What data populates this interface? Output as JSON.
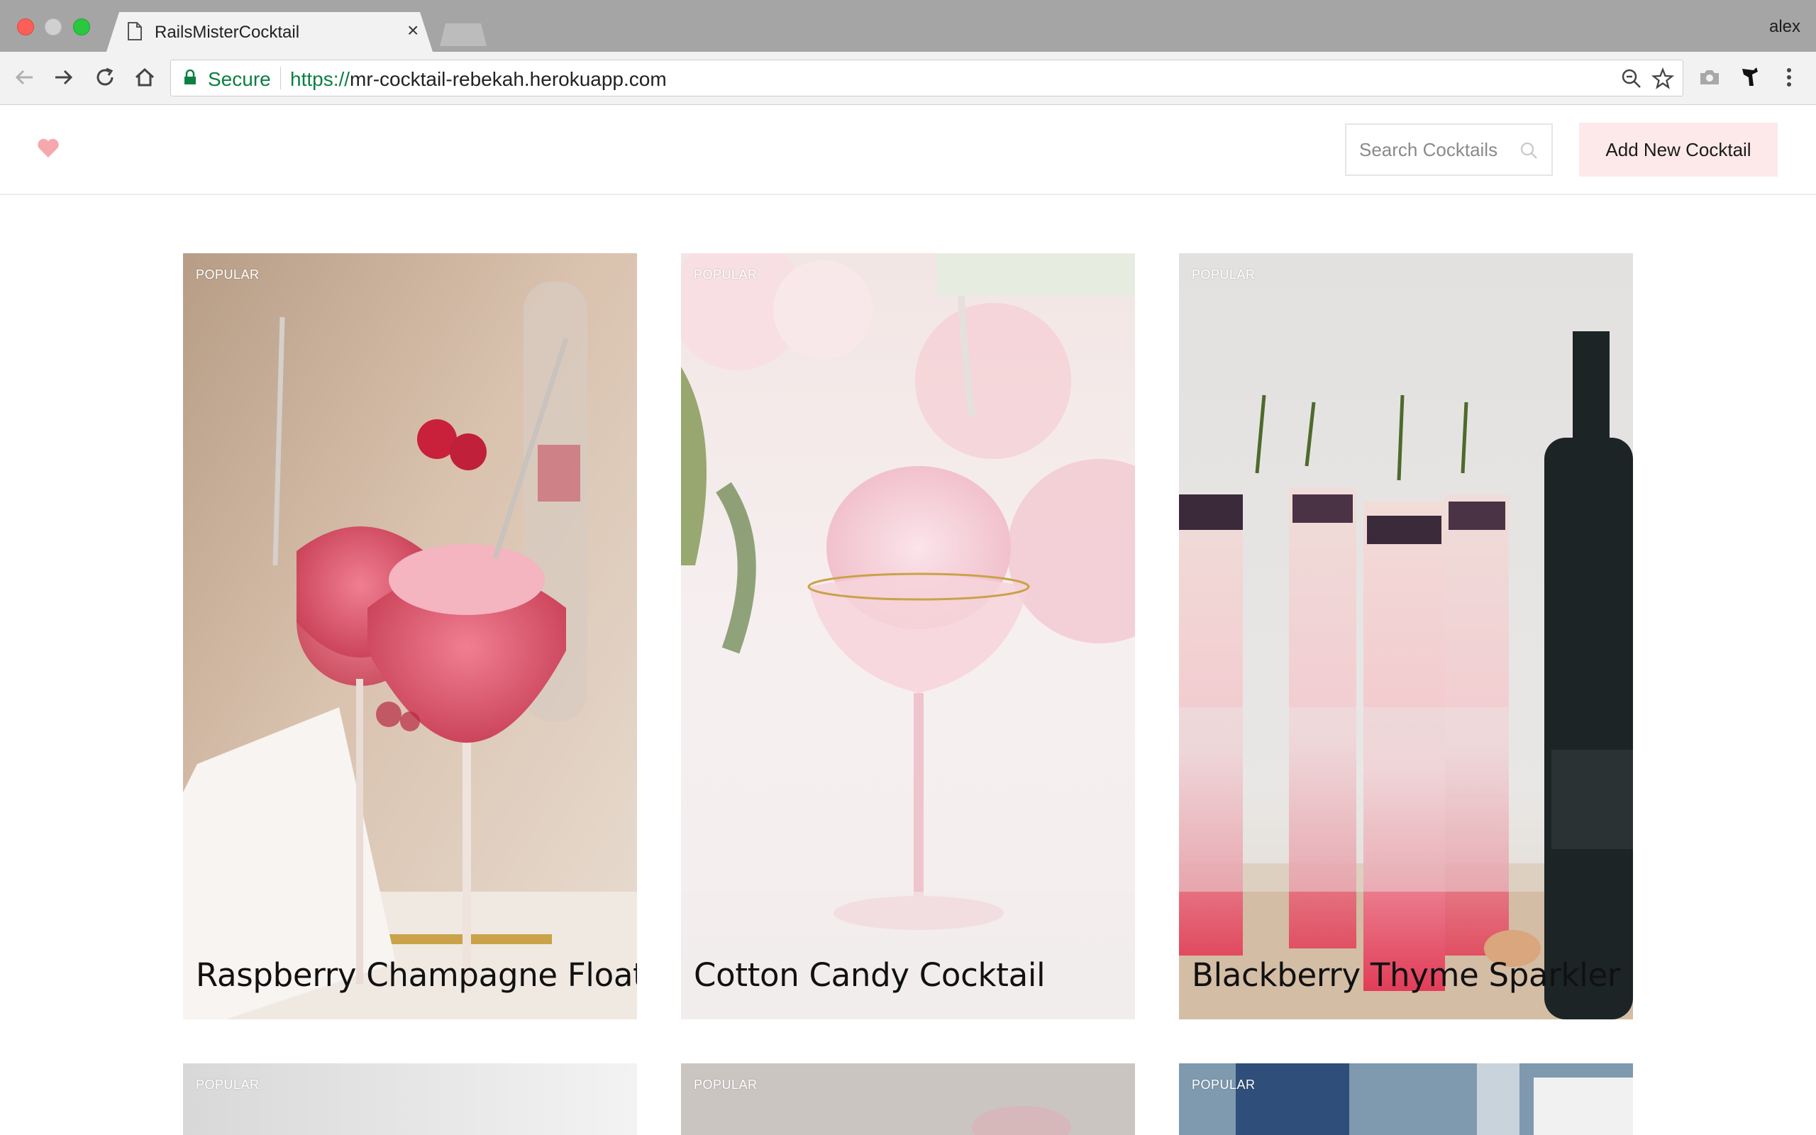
{
  "browser": {
    "tab_title": "RailsMisterCocktail",
    "tab_close": "×",
    "profile_name": "alex",
    "security_label": "Secure",
    "url_scheme": "https://",
    "url_host": "mr-cocktail-rebekah.herokuapp.com",
    "icons": [
      "back-icon",
      "forward-icon",
      "reload-icon",
      "home-icon",
      "lock-icon",
      "zoom-icon",
      "bookmark-star-icon",
      "camera-icon",
      "extension-icon",
      "menu-icon"
    ]
  },
  "header": {
    "logo_icon": "heart-icon",
    "logo_color": "#f7a8ad",
    "search_placeholder": "Search Cocktails",
    "add_button_label": "Add New Cocktail",
    "add_button_color": "#fde9ea"
  },
  "cocktails": [
    {
      "badge": "POPULAR",
      "title": "Raspberry Champagne Float"
    },
    {
      "badge": "POPULAR",
      "title": "Cotton Candy Cocktail"
    },
    {
      "badge": "POPULAR",
      "title": "Blackberry Thyme Sparkler"
    },
    {
      "badge": "POPULAR",
      "title": ""
    },
    {
      "badge": "POPULAR",
      "title": ""
    },
    {
      "badge": "POPULAR",
      "title": ""
    }
  ]
}
